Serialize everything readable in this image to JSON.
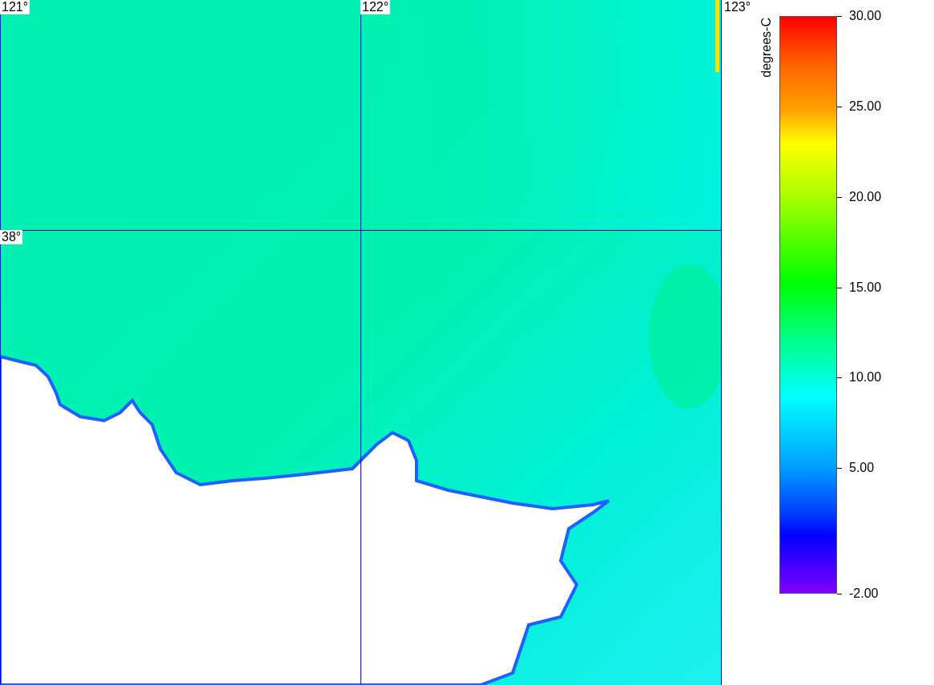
{
  "map": {
    "grid_labels": [
      {
        "text": "121°",
        "kind": "lon"
      },
      {
        "text": "122°",
        "kind": "lon"
      },
      {
        "text": "123°",
        "kind": "lon"
      },
      {
        "text": "38°",
        "kind": "lat"
      }
    ]
  },
  "colorbar": {
    "unit": "degrees-C",
    "ticks": [
      "30.00",
      "25.00",
      "20.00",
      "15.00",
      "10.00",
      "5.00",
      "-2.00"
    ]
  }
}
